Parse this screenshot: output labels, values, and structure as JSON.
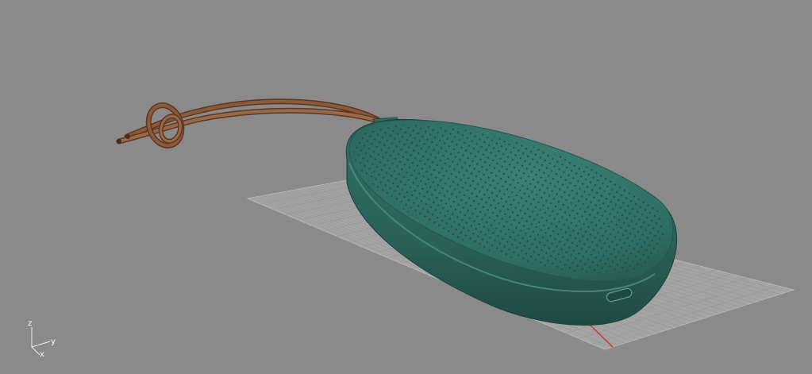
{
  "viewport": {
    "background": "#8a8a8a",
    "grid_color": "#a4a4a4",
    "grid_line_color": "#9a9a9a",
    "x_axis_color": "#c84030"
  },
  "axes_gizmo": {
    "z_label": "z",
    "y_label": "y",
    "x_label": "x"
  },
  "model": {
    "body_color": "#2f6b60",
    "strap_color": "#7a4a2e"
  }
}
